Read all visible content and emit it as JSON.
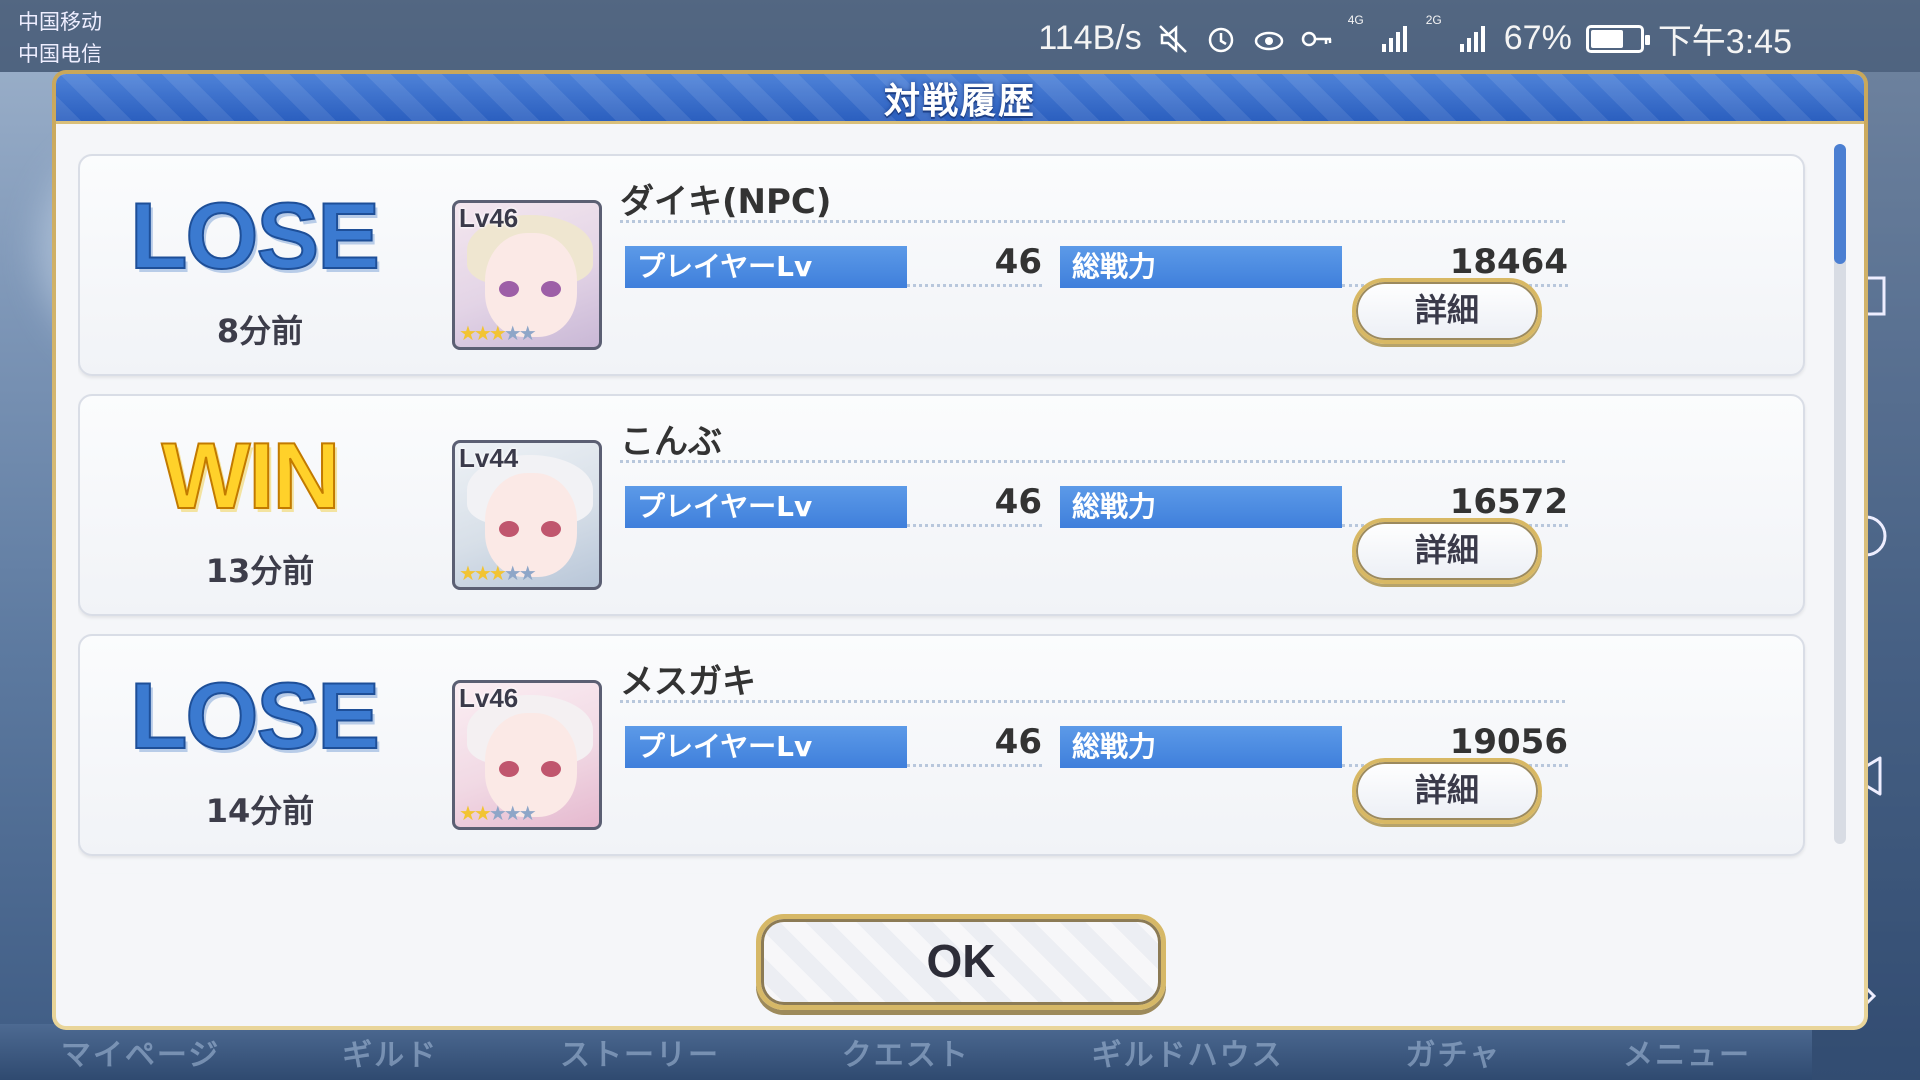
{
  "status_bar": {
    "carrier_1": "中国移动",
    "carrier_2": "中国电信",
    "net_speed": "114B/s",
    "net_4g": "4G",
    "net_2g": "2G",
    "battery": "67%",
    "battery_level": 0.67,
    "time": "下午3:45"
  },
  "background_nav": [
    "マイページ",
    "ギルド",
    "ストーリー",
    "クエスト",
    "ギルドハウス",
    "ガチャ",
    "メニュー"
  ],
  "dialog": {
    "title": "対戦履歴",
    "ok_label": "OK",
    "entries": [
      {
        "result": "LOSE",
        "time_ago": "8分前",
        "player_name": "ダイキ(NPC)",
        "char_level": "Lv46",
        "stars": 3,
        "player_lv_label": "プレイヤーLv",
        "player_lv": "46",
        "power_label": "総戦力",
        "power": "18464",
        "detail_label": "詳細"
      },
      {
        "result": "WIN",
        "time_ago": "13分前",
        "player_name": "こんぶ",
        "char_level": "Lv44",
        "stars": 3,
        "player_lv_label": "プレイヤーLv",
        "player_lv": "46",
        "power_label": "総戦力",
        "power": "16572",
        "detail_label": "詳細"
      },
      {
        "result": "LOSE",
        "time_ago": "14分前",
        "player_name": "メスガキ",
        "char_level": "Lv46",
        "stars": 2,
        "player_lv_label": "プレイヤーLv",
        "player_lv": "46",
        "power_label": "総戦力",
        "power": "19056",
        "detail_label": "詳細"
      }
    ]
  },
  "colors": {
    "title_blue": "#2b5fbf",
    "tag_blue": "#3f7fdb",
    "lose_blue": "#3b7ad0",
    "win_gold": "#ffd12a",
    "frame_gold": "#d6b867"
  }
}
